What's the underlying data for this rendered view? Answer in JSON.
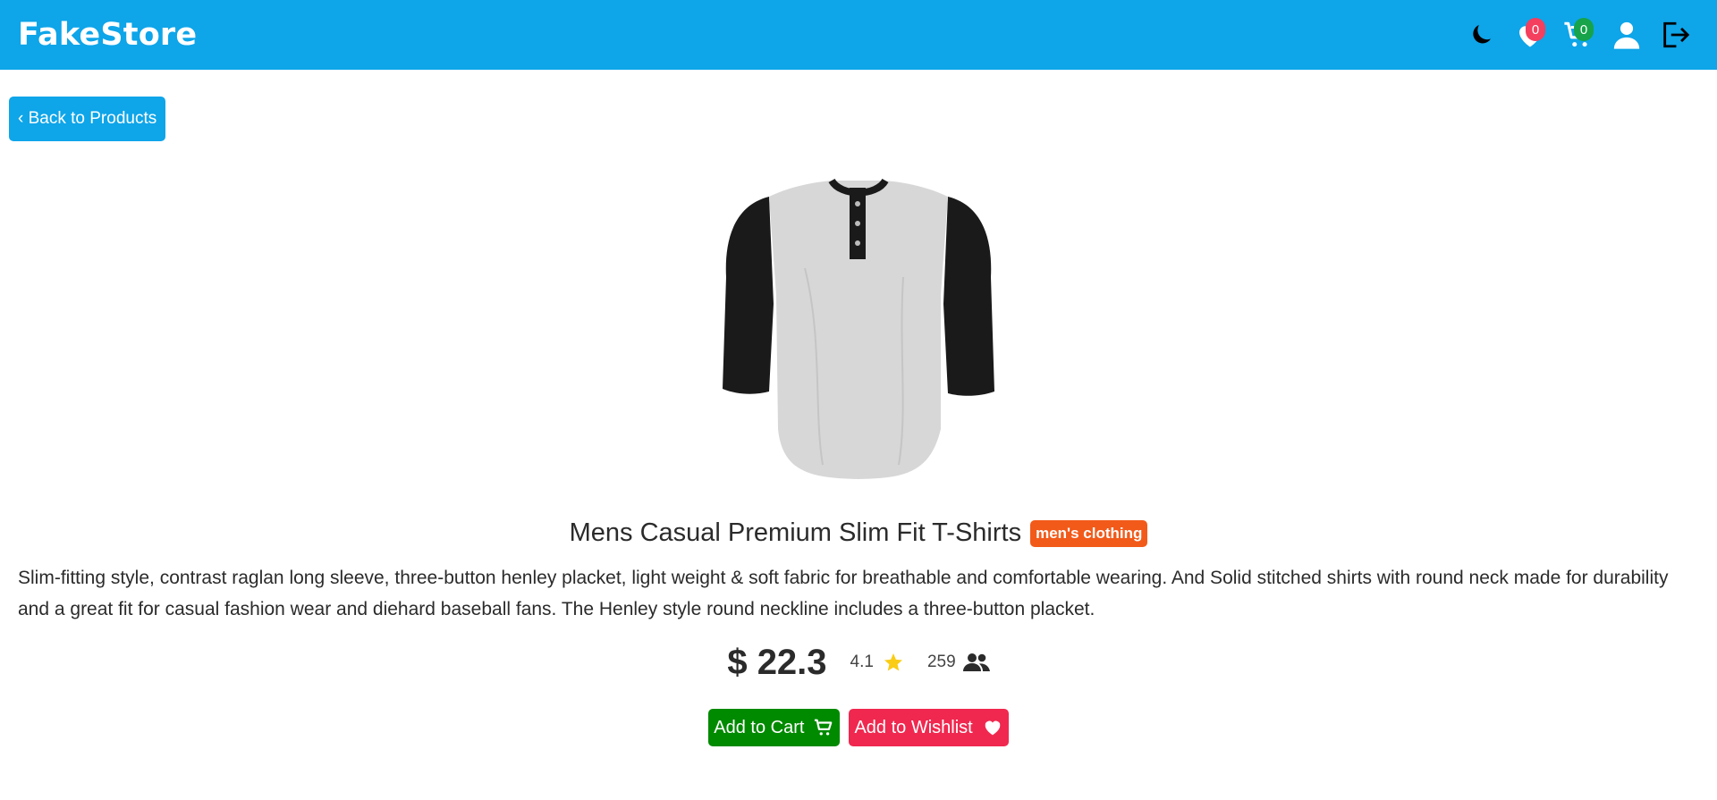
{
  "navbar": {
    "brand": "FakeStore",
    "wishlist_count": "0",
    "cart_count": "0",
    "icons": [
      "moon-icon",
      "heart-icon",
      "cart-icon",
      "user-icon",
      "logout-icon"
    ],
    "colors": {
      "bar": "#0ea5e9",
      "wishlist_badge": "#f43f5e",
      "cart_badge": "#16a34a"
    }
  },
  "back_button": {
    "label": "‹ Back to Products"
  },
  "product": {
    "title": "Mens Casual Premium Slim Fit T-Shirts",
    "category": "men's clothing",
    "description": "Slim-fitting style, contrast raglan long sleeve, three-button henley placket, light weight & soft fabric for breathable and comfortable wearing. And Solid stitched shirts with round neck made for durability and a great fit for casual fashion wear and diehard baseball fans. The Henley style round neckline includes a three-button placket.",
    "price": "$ 22.3",
    "rating": "4.1",
    "rating_count": "259"
  },
  "actions": {
    "add_to_cart": "Add to Cart",
    "add_to_wishlist": "Add to Wishlist",
    "colors": {
      "cart": "#008a00",
      "wishlist": "#f0284f"
    }
  }
}
